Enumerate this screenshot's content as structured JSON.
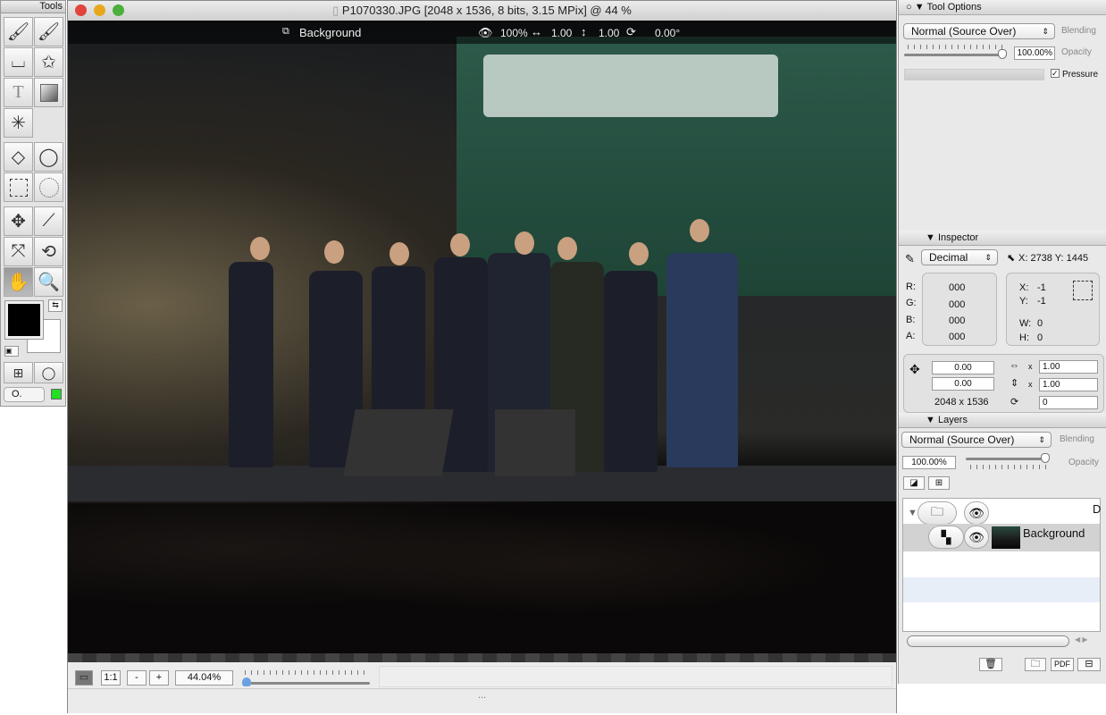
{
  "tools_palette": {
    "title": "Tools",
    "tools": [
      "paintbrush",
      "pencil-brush",
      "eraser",
      "clone-stamp",
      "text",
      "gradient",
      "magic-wand",
      "polygon-lasso",
      "lasso",
      "rect-select",
      "ellipse-select",
      "move",
      "eyedropper",
      "transform",
      "rotate",
      "hand",
      "zoom"
    ],
    "foreground": "#000000",
    "background": "#ffffff",
    "mode_select": "O.",
    "indicator_color": "#22dd22"
  },
  "document": {
    "title": "P1070330.JPG [2048 x 1536, 8 bits, 3.15 MPix] @ 44 %",
    "layer_name": "Background",
    "opacity": "100%",
    "scale_x": "1.00",
    "scale_y": "1.00",
    "rotation": "0.00°"
  },
  "zoom_bar": {
    "fit_label": "",
    "one_to_one": "1:1",
    "minus": "-",
    "plus": "+",
    "zoom_value": "44.04%",
    "zoom_slider_fraction": 0.02,
    "resize_handle": "..."
  },
  "tool_options": {
    "title": "Tool Options",
    "blending_value": "Normal (Source Over)",
    "blending_label": "Blending",
    "opacity_value": "100.00%",
    "opacity_label": "Opacity",
    "pressure_label": "Pressure",
    "pressure_checked": true
  },
  "inspector": {
    "title": "Inspector",
    "mode": "Decimal",
    "cursor_pos": "X: 2738 Y: 1445",
    "rgba_labels": [
      "R:",
      "G:",
      "B:",
      "A:"
    ],
    "rgba_values": [
      "000",
      "000",
      "000",
      "000"
    ],
    "sel": {
      "x_label": "X:",
      "x": "-1",
      "y_label": "Y:",
      "y": "-1",
      "w_label": "W:",
      "w": "0",
      "h_label": "H:",
      "h": "0"
    },
    "offset_x": "0.00",
    "offset_y": "0.00",
    "size": "2048 x 1536",
    "scale_x": "1.00",
    "scale_y": "1.00",
    "x_sign": "x",
    "rotation": "0"
  },
  "layers": {
    "title": "Layers",
    "blending_value": "Normal (Source Over)",
    "blending_label": "Blending",
    "opacity_value": "100.00%",
    "opacity_label": "Opacity",
    "group_letter": "D",
    "layer_name": "Background",
    "buttons": [
      "trash",
      "new-folder",
      "PDF",
      "new-layer"
    ]
  }
}
